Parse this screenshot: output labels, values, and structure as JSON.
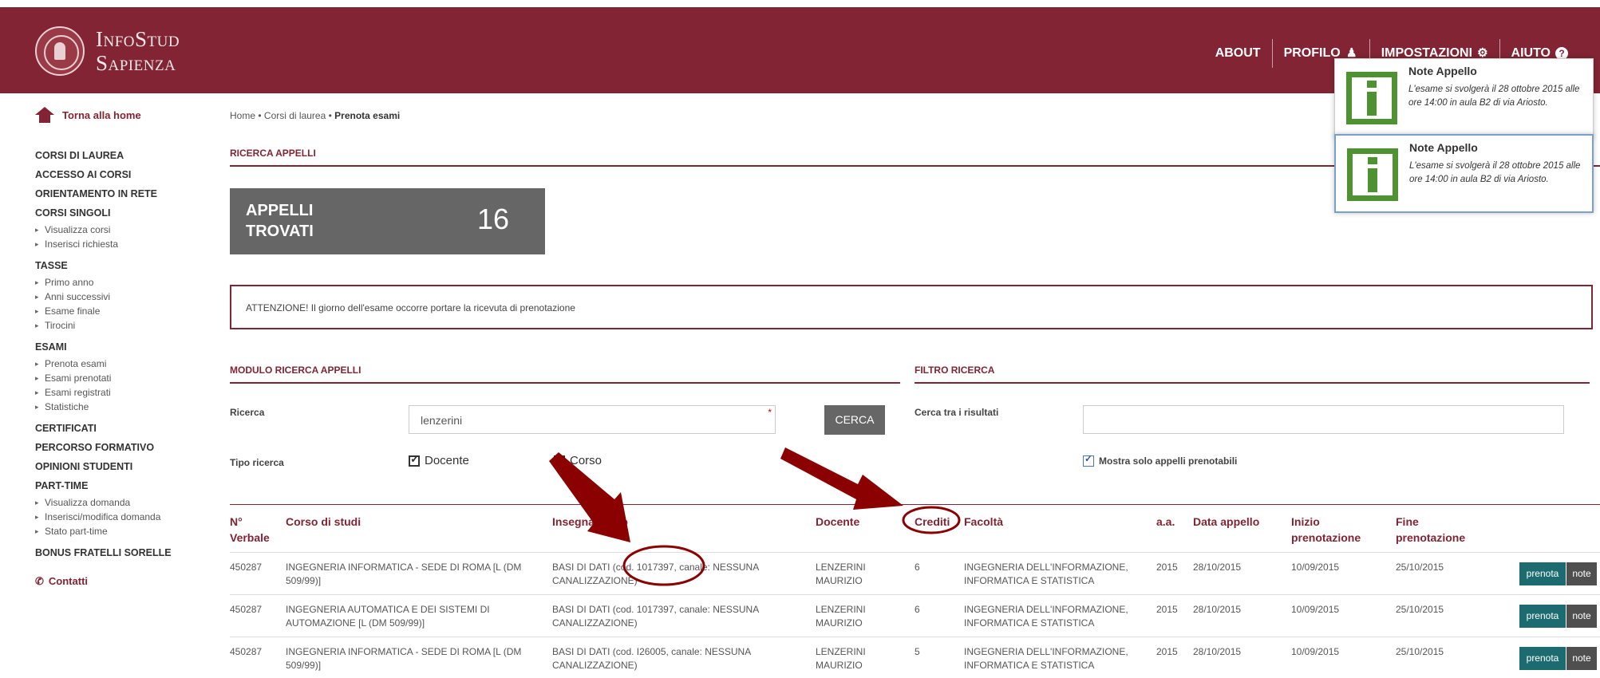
{
  "brand": {
    "line1": "InfoStud",
    "line2": "Sapienza"
  },
  "topnav": [
    {
      "label": "ABOUT",
      "icon": ""
    },
    {
      "label": "PROFILO",
      "icon": "user-icon"
    },
    {
      "label": "IMPOSTAZIONI",
      "icon": "gear-icon"
    },
    {
      "label": "AIUTO",
      "icon": "help-icon"
    }
  ],
  "sidebar": {
    "home": "Torna alla home",
    "groups": [
      {
        "title": "CORSI DI LAUREA",
        "items": []
      },
      {
        "title": "ACCESSO AI CORSI",
        "items": []
      },
      {
        "title": "ORIENTAMENTO IN RETE",
        "items": []
      },
      {
        "title": "CORSI SINGOLI",
        "items": [
          "Visualizza corsi",
          "Inserisci richiesta"
        ]
      },
      {
        "title": "TASSE",
        "items": [
          "Primo anno",
          "Anni successivi",
          "Esame finale",
          "Tirocini"
        ]
      },
      {
        "title": "ESAMI",
        "items": [
          "Prenota esami",
          "Esami prenotati",
          "Esami registrati",
          "Statistiche"
        ]
      },
      {
        "title": "CERTIFICATI",
        "items": []
      },
      {
        "title": "PERCORSO FORMATIVO",
        "items": []
      },
      {
        "title": "OPINIONI STUDENTI",
        "items": []
      },
      {
        "title": "PART-TIME",
        "items": [
          "Visualizza domanda",
          "Inserisci/modifica domanda",
          "Stato part-time"
        ]
      },
      {
        "title": "BONUS FRATELLI SORELLE",
        "items": []
      }
    ],
    "contacts": "Contatti"
  },
  "breadcrumb": {
    "home": "Home",
    "corsi": "Corsi di laurea",
    "current": "Prenota esami"
  },
  "ricerca_title": "RICERCA APPELLI",
  "count": {
    "label": "APPELLI TROVATI",
    "value": "16"
  },
  "alert": "ATTENZIONE! Il giorno dell'esame occorre portare la ricevuta di prenotazione",
  "modulo_title": "MODULO RICERCA APPELLI",
  "filtro_title": "FILTRO RICERCA",
  "form": {
    "ricerca_label": "Ricerca",
    "ricerca_value": "lenzerini",
    "required_mark": "*",
    "cerca": "CERCA",
    "tipo_label": "Tipo ricerca",
    "docente": "Docente",
    "corso": "Corso",
    "cerca_tra_label": "Cerca tra i risultati",
    "cerca_tra_value": "",
    "mostra": "Mostra solo appelli prenotabili"
  },
  "table": {
    "headers": {
      "verbale": "N° Verbale",
      "corso": "Corso di studi",
      "insegnamento": "Insegnamento",
      "docente": "Docente",
      "crediti": "Crediti",
      "facolta": "Facoltà",
      "aa": "a.a.",
      "data": "Data appello",
      "inizio": "Inizio prenotazione",
      "fine": "Fine prenotazione"
    },
    "rows": [
      {
        "verbale": "450287",
        "corso": "INGEGNERIA INFORMATICA - SEDE DI ROMA [L (DM 509/99)]",
        "insegnamento": "BASI DI DATI (cod. 1017397, canale: NESSUNA CANALIZZAZIONE)",
        "docente": "LENZERINI MAURIZIO",
        "crediti": "6",
        "facolta": "INGEGNERIA DELL'INFORMAZIONE, INFORMATICA E STATISTICA",
        "aa": "2015",
        "data": "28/10/2015",
        "inizio": "10/09/2015",
        "fine": "25/10/2015"
      },
      {
        "verbale": "450287",
        "corso": "INGEGNERIA AUTOMATICA E DEI SISTEMI DI AUTOMAZIONE [L (DM 509/99)]",
        "insegnamento": "BASI DI DATI (cod. 1017397, canale: NESSUNA CANALIZZAZIONE)",
        "docente": "LENZERINI MAURIZIO",
        "crediti": "6",
        "facolta": "INGEGNERIA DELL'INFORMAZIONE, INFORMATICA E STATISTICA",
        "aa": "2015",
        "data": "28/10/2015",
        "inizio": "10/09/2015",
        "fine": "25/10/2015"
      },
      {
        "verbale": "450287",
        "corso": "INGEGNERIA INFORMATICA - SEDE DI ROMA [L (DM 509/99)]",
        "insegnamento": "BASI DI DATI (cod. I26005, canale: NESSUNA CANALIZZAZIONE)",
        "docente": "LENZERINI MAURIZIO",
        "crediti": "5",
        "facolta": "INGEGNERIA DELL'INFORMAZIONE, INFORMATICA E STATISTICA",
        "aa": "2015",
        "data": "28/10/2015",
        "inizio": "10/09/2015",
        "fine": "25/10/2015"
      }
    ],
    "prenota": "prenota",
    "note": "note"
  },
  "popups": [
    {
      "title": "Note Appello",
      "text": "L'esame si svolgerà il 28 ottobre 2015 alle ore 14:00 in aula B2 di via Ariosto."
    },
    {
      "title": "Note Appello",
      "text": "L'esame si svolgerà il 28 ottobre 2015 alle ore 14:00 in aula B2 di via Ariosto."
    }
  ],
  "colors": {
    "brand": "#822433",
    "button_dark": "#666666",
    "prenota": "#1b6b71",
    "info_green": "#4e9232",
    "annotation": "#8b0000"
  }
}
